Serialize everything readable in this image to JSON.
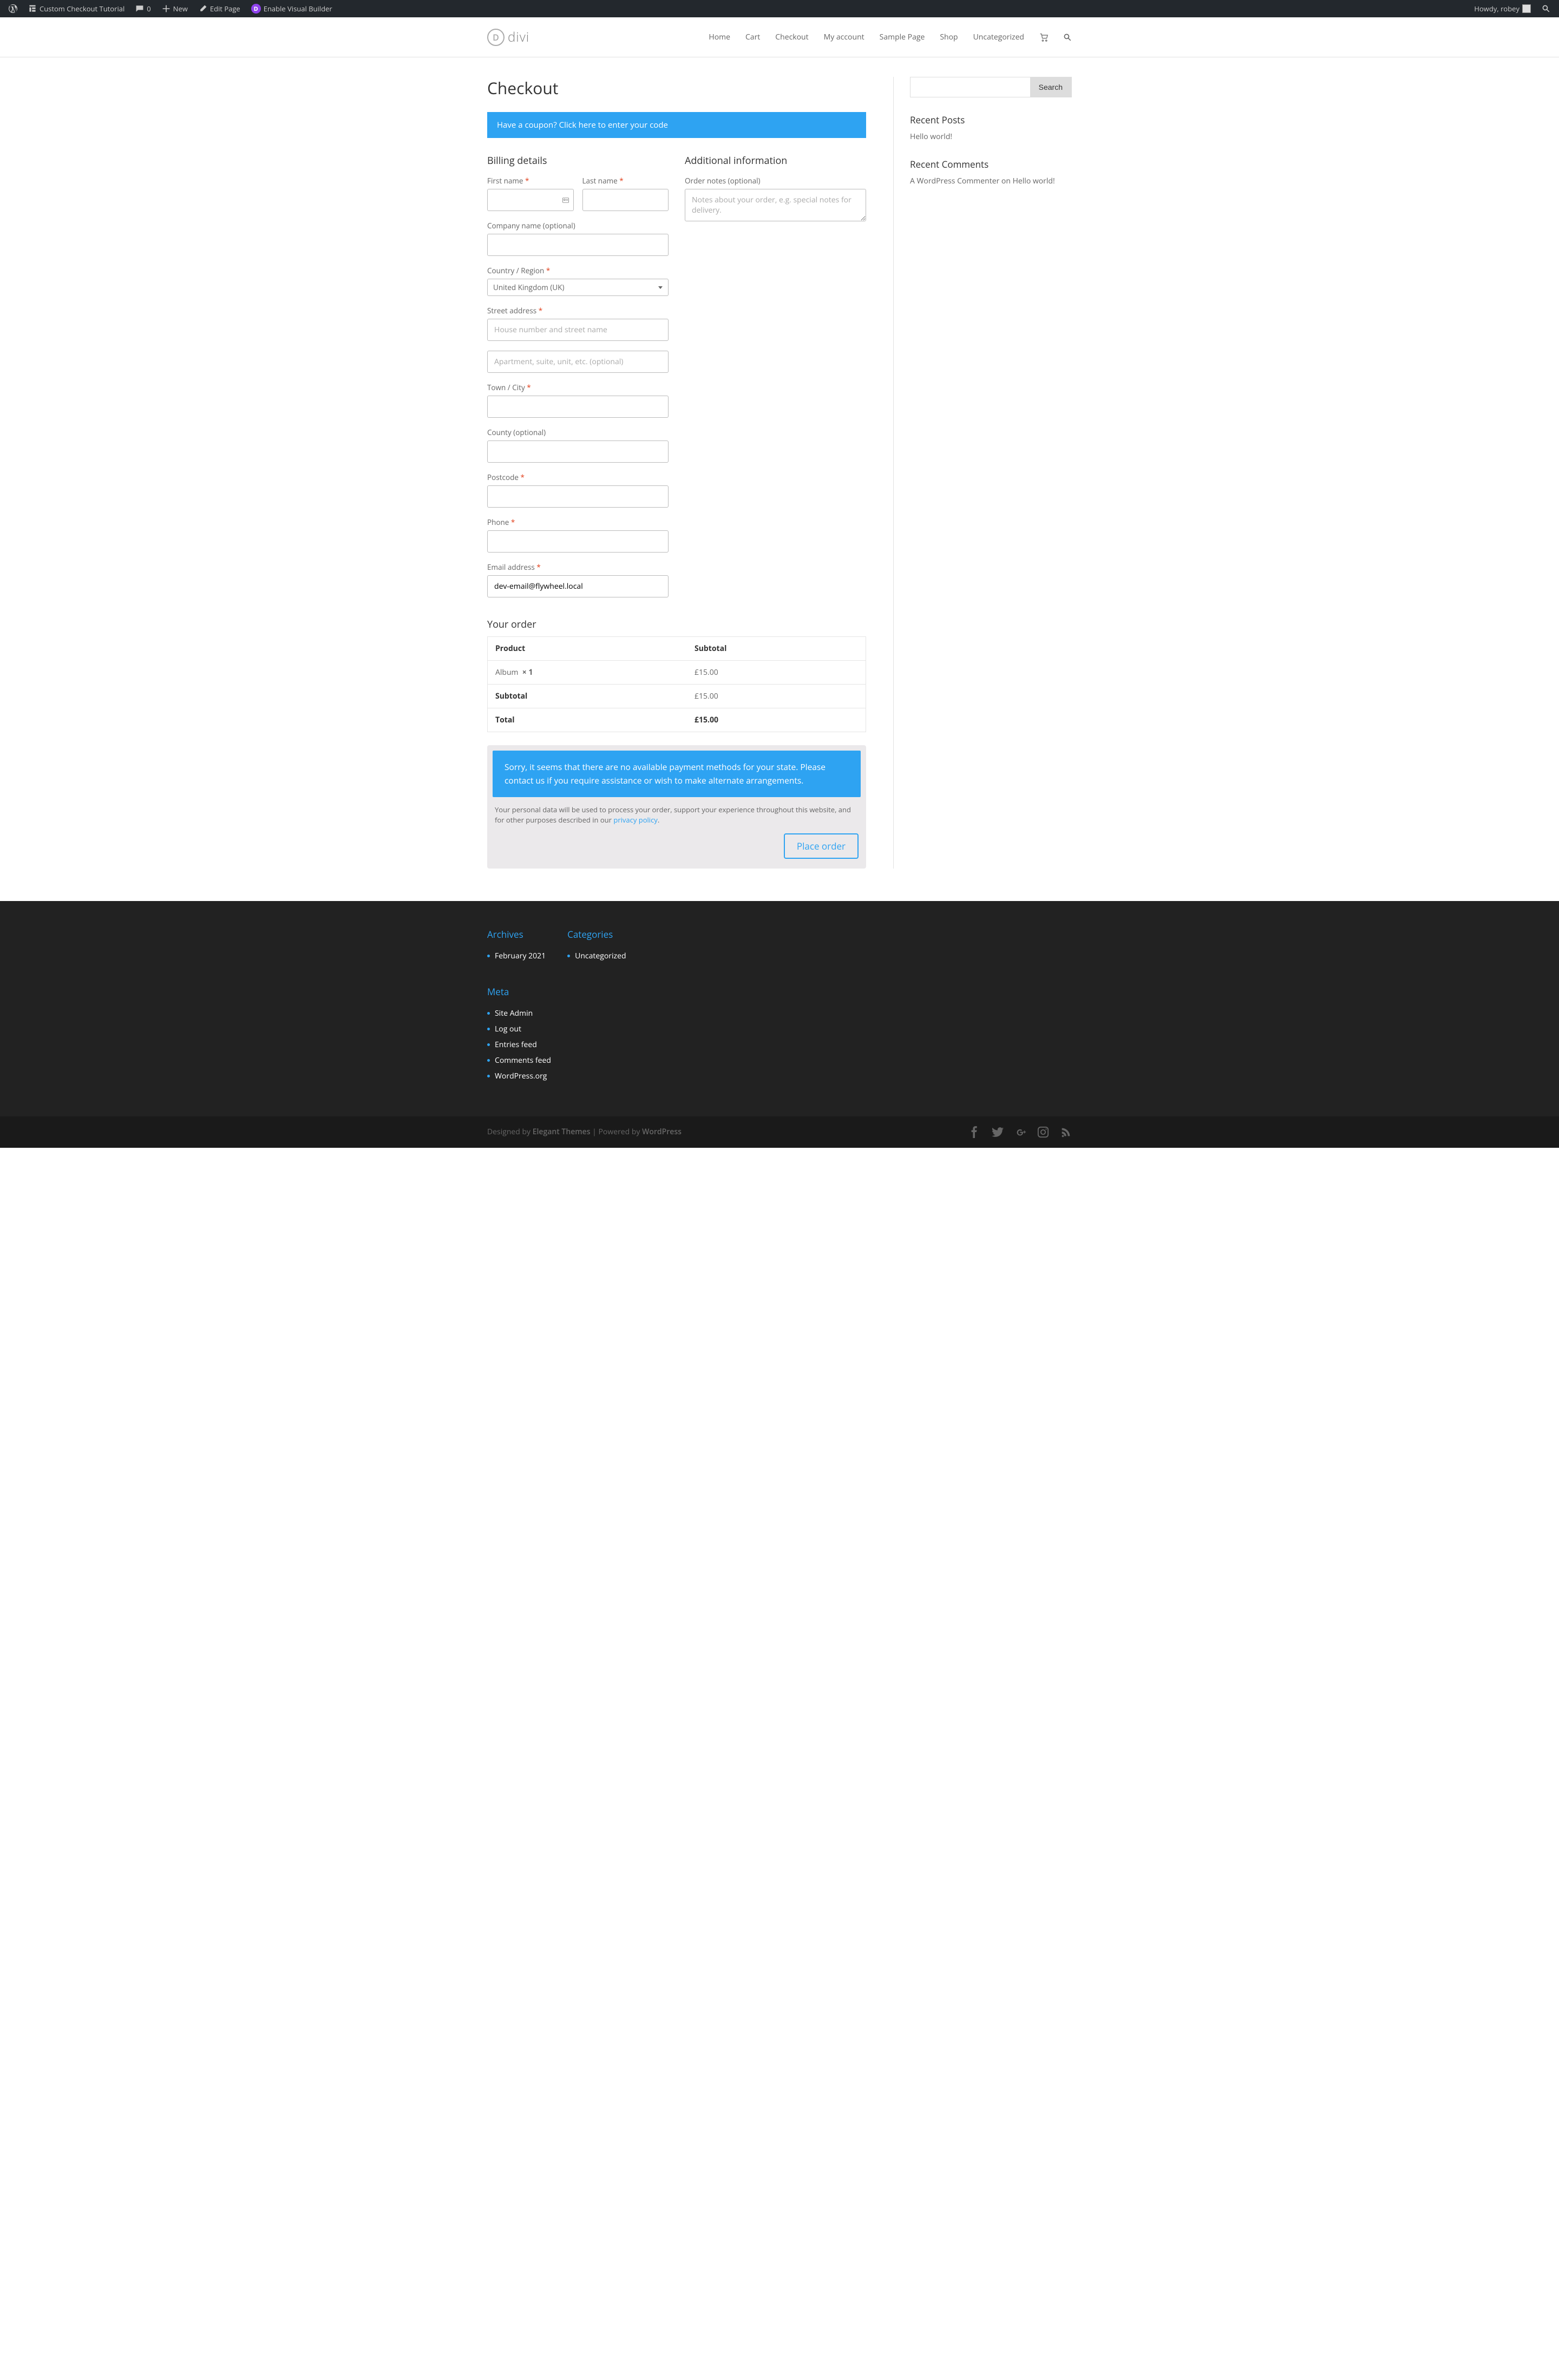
{
  "admin_bar": {
    "site_title": "Custom Checkout Tutorial",
    "comments": "0",
    "new": "New",
    "edit": "Edit Page",
    "visual_builder": "Enable Visual Builder",
    "howdy": "Howdy, robey"
  },
  "nav": {
    "logo": "divi",
    "items": [
      "Home",
      "Cart",
      "Checkout",
      "My account",
      "Sample Page",
      "Shop",
      "Uncategorized"
    ]
  },
  "page": {
    "title": "Checkout",
    "coupon_prompt": "Have a coupon? Click here to enter your code"
  },
  "billing": {
    "heading": "Billing details",
    "first_name": "First name",
    "last_name": "Last name",
    "company": "Company name (optional)",
    "country": "Country / Region",
    "country_value": "United Kingdom (UK)",
    "street": "Street address",
    "street_ph": "House number and street name",
    "street2_ph": "Apartment, suite, unit, etc. (optional)",
    "town": "Town / City",
    "county": "County (optional)",
    "postcode": "Postcode",
    "phone": "Phone",
    "email": "Email address",
    "email_value": "dev-email@flywheel.local"
  },
  "additional": {
    "heading": "Additional information",
    "notes_label": "Order notes (optional)",
    "notes_ph": "Notes about your order, e.g. special notes for delivery."
  },
  "order": {
    "heading": "Your order",
    "product_h": "Product",
    "subtotal_h": "Subtotal",
    "item_name": "Album",
    "item_qty": "× 1",
    "item_price": "£15.00",
    "subtotal_label": "Subtotal",
    "subtotal_value": "£15.00",
    "total_label": "Total",
    "total_value": "£15.00"
  },
  "payment": {
    "notice": "Sorry, it seems that there are no available payment methods for your state. Please contact us if you require assistance or wish to make alternate arrangements.",
    "privacy_pre": "Your personal data will be used to process your order, support your experience throughout this website, and for other purposes described in our ",
    "privacy_link": "privacy policy",
    "place_order": "Place order"
  },
  "sidebar": {
    "search_btn": "Search",
    "recent_posts_h": "Recent Posts",
    "recent_post_1": "Hello world!",
    "recent_comments_h": "Recent Comments",
    "commenter": "A WordPress Commenter",
    "on": " on ",
    "comment_post": "Hello world!"
  },
  "footer": {
    "archives_h": "Archives",
    "archive_1": "February 2021",
    "categories_h": "Categories",
    "category_1": "Uncategorized",
    "meta_h": "Meta",
    "meta_items": [
      "Site Admin",
      "Log out",
      "Entries feed",
      "Comments feed",
      "WordPress.org"
    ],
    "credits_pre": "Designed by ",
    "credits_theme": "Elegant Themes",
    "credits_mid": " | Powered by ",
    "credits_wp": "WordPress"
  }
}
